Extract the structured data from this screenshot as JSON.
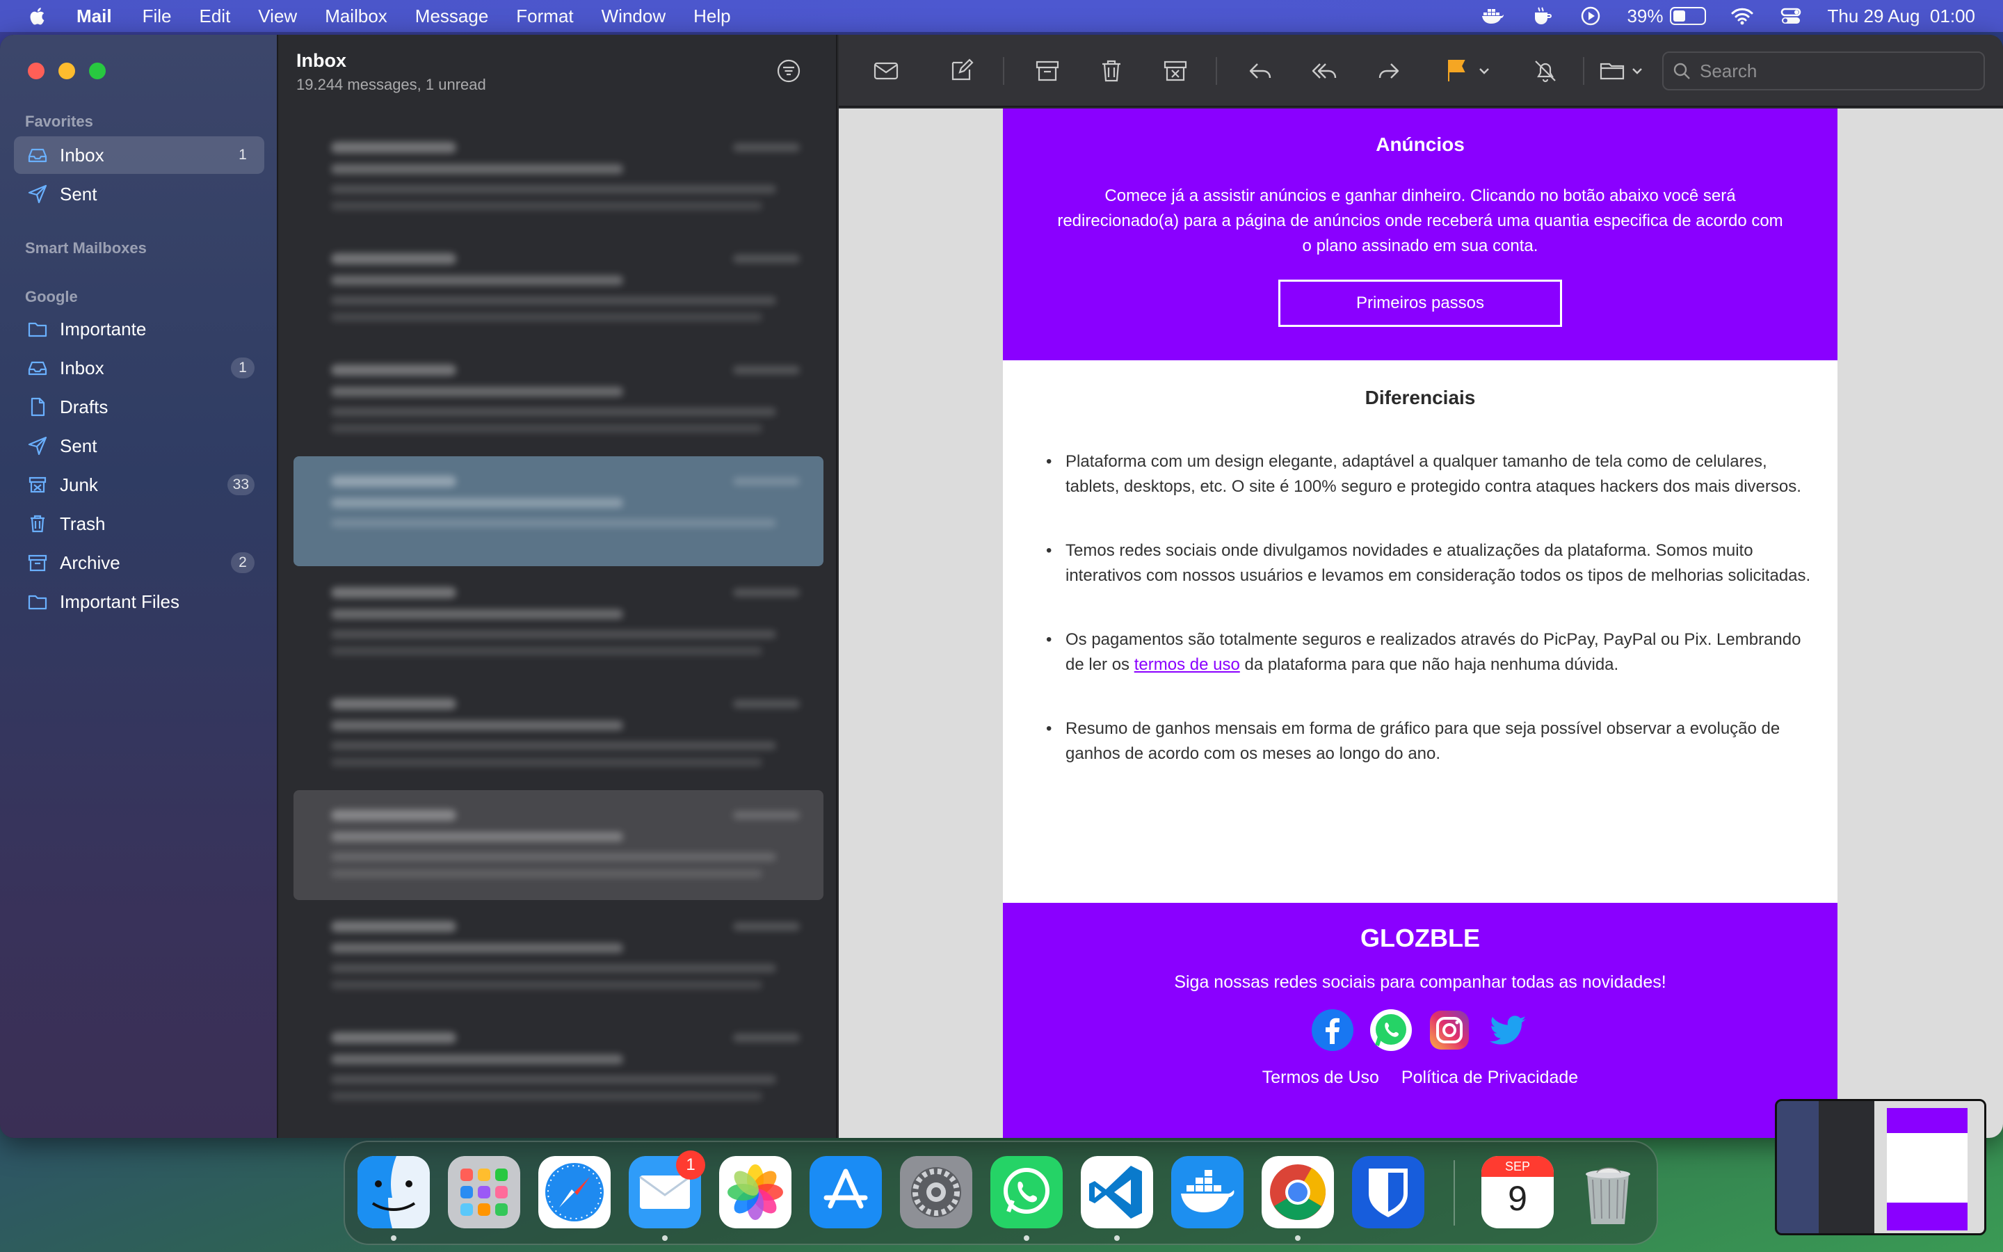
{
  "menubar": {
    "app": "Mail",
    "items": [
      "File",
      "Edit",
      "View",
      "Mailbox",
      "Message",
      "Format",
      "Window",
      "Help"
    ],
    "battery": "39%",
    "battery_level": 0.39,
    "datetime": "Thu 29 Aug  01:00"
  },
  "sidebar": {
    "favorites_label": "Favorites",
    "smart_label": "Smart Mailboxes",
    "google_label": "Google",
    "favorites": [
      {
        "label": "Inbox",
        "badge": "1",
        "icon": "inbox-icon"
      },
      {
        "label": "Sent",
        "icon": "sent-icon"
      }
    ],
    "google": [
      {
        "label": "Importante",
        "icon": "folder-icon"
      },
      {
        "label": "Inbox",
        "badge": "1",
        "icon": "inbox-icon"
      },
      {
        "label": "Drafts",
        "icon": "drafts-icon"
      },
      {
        "label": "Sent",
        "icon": "sent-icon"
      },
      {
        "label": "Junk",
        "badge": "33",
        "icon": "junk-icon"
      },
      {
        "label": "Trash",
        "icon": "trash-icon"
      },
      {
        "label": "Archive",
        "badge": "2",
        "icon": "archive-icon"
      },
      {
        "label": "Important Files",
        "icon": "folder-icon"
      }
    ]
  },
  "msglist": {
    "title": "Inbox",
    "subtitle": "19.244 messages, 1 unread"
  },
  "toolbar": {
    "search_placeholder": "Search",
    "flag_color": "#f5a623"
  },
  "email": {
    "ads_title": "Anúncios",
    "ads_text": "Comece já a assistir anúncios e ganhar dinheiro. Clicando no botão abaixo você será redirecionado(a) para a página de anúncios onde receberá uma quantia especifica de acordo com o plano assinado em sua conta.",
    "ads_button": "Primeiros passos",
    "diff_title": "Diferenciais",
    "bullet1": "Plataforma com um design elegante, adaptável a qualquer tamanho de tela como de celulares, tablets, desktops, etc. O site é 100% seguro e protegido contra ataques hackers dos mais diversos.",
    "bullet2": "Temos redes sociais onde divulgamos novidades e atualizações da plataforma. Somos muito interativos com nossos usuários e levamos em consideração todos os tipos de melhorias solicitadas.",
    "bullet3_pre": "Os pagamentos são totalmente seguros e realizados através do PicPay, PayPal ou Pix. Lembrando de ler os ",
    "bullet3_link": "termos de uso",
    "bullet3_post": " da plataforma para que não haja nenhuma dúvida.",
    "bullet4": "Resumo de ganhos mensais em forma de gráfico para que seja possível observar a evolução de ganhos de acordo com os meses ao longo do ano.",
    "footer_brand": "GLOZBLE",
    "footer_text": "Siga nossas redes sociais para companhar todas as novidades!",
    "footer_link1": "Termos de Uso",
    "footer_link2": "Política de Privacidade",
    "brand_color": "#8a00ff"
  },
  "dock": {
    "mail_badge": "1",
    "calendar_month": "SEP",
    "calendar_day": "9",
    "apps": [
      "Finder",
      "Launchpad",
      "Safari",
      "Mail",
      "Photos",
      "App Store",
      "System Settings",
      "WhatsApp",
      "Visual Studio Code",
      "Docker",
      "Chrome",
      "Bitwarden",
      "Calendar",
      "Trash"
    ]
  }
}
